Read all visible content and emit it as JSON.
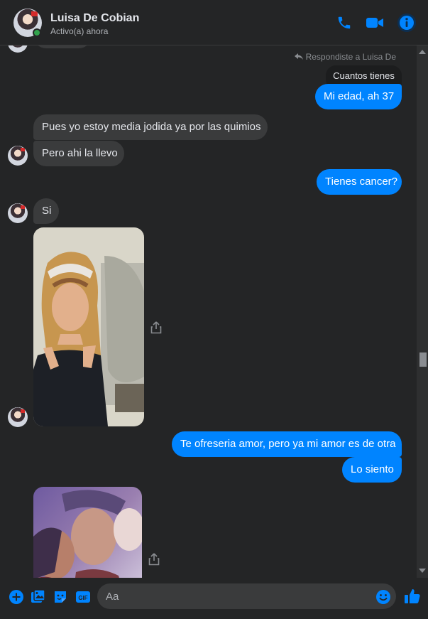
{
  "header": {
    "contact_name": "Luisa De Cobian",
    "status": "Activo(a) ahora"
  },
  "conversation": {
    "reply_note": "Respondiste a Luisa De",
    "quoted_message": "Cuantos tienes",
    "messages": [
      {
        "id": "m1",
        "text": "Mi edad, ah 37",
        "sender": "me"
      },
      {
        "id": "m2",
        "text": "Pues yo estoy media jodida ya por las quimios",
        "sender": "contact"
      },
      {
        "id": "m3",
        "text": "Pero ahi la llevo",
        "sender": "contact"
      },
      {
        "id": "m4",
        "text": "Tienes cancer?",
        "sender": "me"
      },
      {
        "id": "m5",
        "text": "Si",
        "sender": "contact"
      },
      {
        "id": "m6",
        "text": "Te ofreseria amor, pero ya mi amor es de otra",
        "sender": "me"
      },
      {
        "id": "m7",
        "text": "Lo siento",
        "sender": "me"
      }
    ]
  },
  "composer": {
    "placeholder": "Aa"
  },
  "colors": {
    "background": "#242526",
    "incoming_bubble": "#3a3b3c",
    "outgoing_bubble": "#0084ff",
    "accent": "#0084ff"
  }
}
